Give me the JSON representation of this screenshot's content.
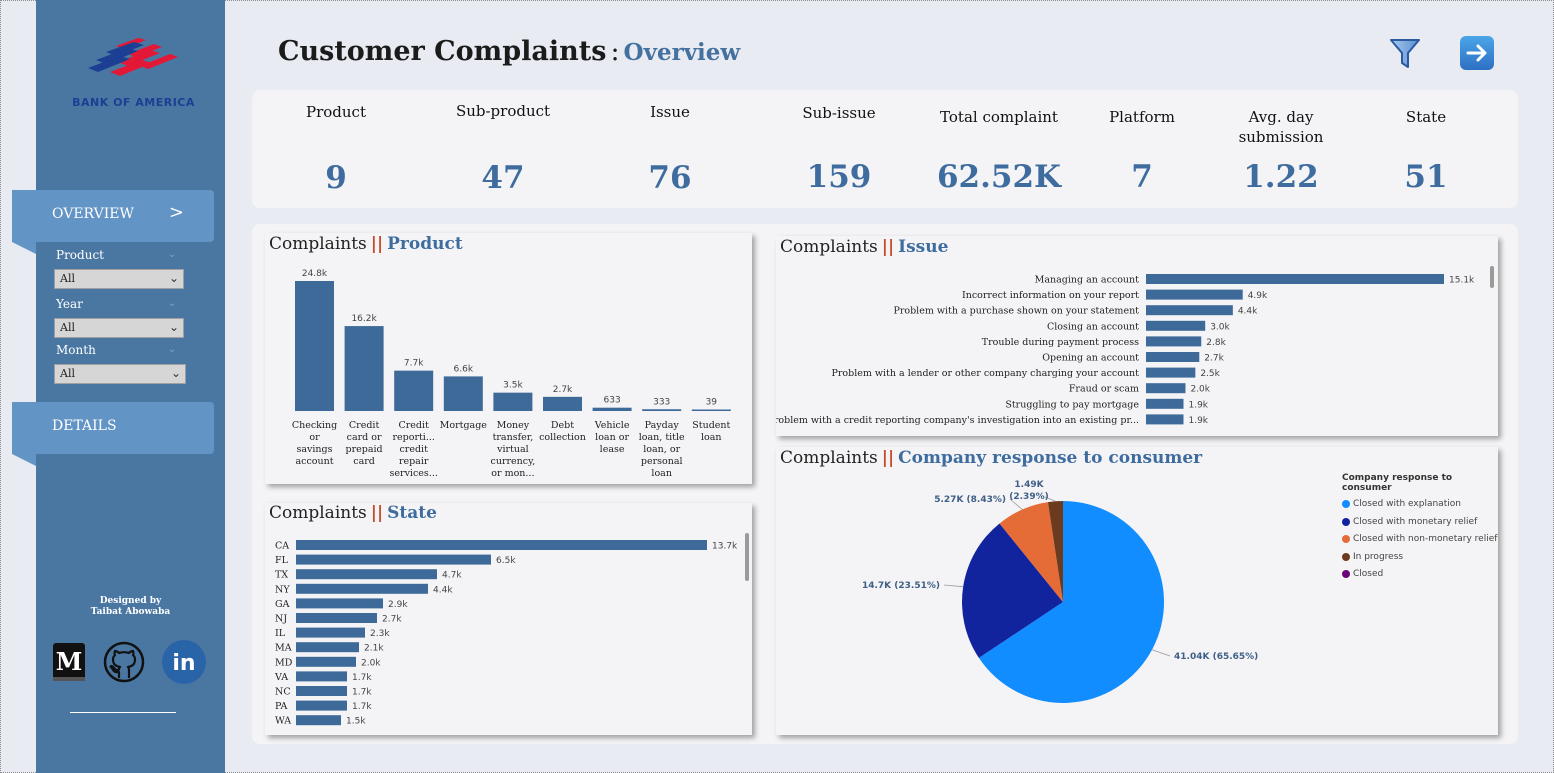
{
  "brand": {
    "logo_text": "BANK OF AMERICA"
  },
  "nav": {
    "overview": {
      "label": "OVERVIEW",
      "chevron": ">"
    },
    "details": {
      "label": "DETAILS"
    }
  },
  "slicers": [
    {
      "label": "Product",
      "value": "All"
    },
    {
      "label": "Year",
      "value": "All"
    },
    {
      "label": "Month",
      "value": "All"
    }
  ],
  "credits": {
    "line1": "Designed by",
    "line2": "Taibat Abowaba"
  },
  "social": [
    {
      "name": "medium-icon",
      "glyph": "M"
    },
    {
      "name": "github-icon"
    },
    {
      "name": "linkedin-icon",
      "glyph": "in"
    }
  ],
  "header": {
    "title": "Customer Complaints",
    "separator": ":",
    "subtitle": "Overview"
  },
  "icons": {
    "filter": "filter-icon",
    "next": "arrow-right-icon"
  },
  "kpis": [
    {
      "label": "Product",
      "value": "9"
    },
    {
      "label": "Sub-product",
      "value": "47"
    },
    {
      "label": "Issue",
      "value": "76"
    },
    {
      "label": "Sub-issue",
      "value": "159"
    },
    {
      "label": "Total complaint",
      "value": "62.52K"
    },
    {
      "label": "Platform",
      "value": "7"
    },
    {
      "label": "Avg. day submission",
      "value": "1.22"
    },
    {
      "label": "State",
      "value": "51"
    }
  ],
  "colors": {
    "bar": "#3d6a98",
    "accent_sep": "#c44a2a",
    "title_blue": "#3f6c9f",
    "sidebar": "#4a76a2",
    "nav_tab": "#6394c6"
  },
  "chart_data": [
    {
      "id": "product",
      "type": "bar",
      "title_prefix": "Complaints",
      "title_separator": "||",
      "title": "Product",
      "categories": [
        [
          "Checking",
          "or",
          "savings",
          "account"
        ],
        [
          "Credit",
          "card or",
          "prepaid",
          "card"
        ],
        [
          "Credit",
          "reporti...",
          "credit",
          "repair",
          "services..."
        ],
        [
          "Mortgage"
        ],
        [
          "Money",
          "transfer,",
          "virtual",
          "currency,",
          "or mon..."
        ],
        [
          "Debt",
          "collection"
        ],
        [
          "Vehicle",
          "loan or",
          "lease"
        ],
        [
          "Payday",
          "loan, title",
          "loan, or",
          "personal",
          "loan"
        ],
        [
          "Student",
          "loan"
        ]
      ],
      "values": [
        24800,
        16200,
        7700,
        6600,
        3500,
        2700,
        633,
        333,
        39
      ],
      "labels": [
        "24.8k",
        "16.2k",
        "7.7k",
        "6.6k",
        "3.5k",
        "2.7k",
        "633",
        "333",
        "39"
      ]
    },
    {
      "id": "issue",
      "type": "bar",
      "orientation": "horizontal",
      "title_prefix": "Complaints",
      "title_separator": "||",
      "title": "Issue",
      "categories": [
        "Managing an account",
        "Incorrect information on your report",
        "Problem with a purchase shown on your statement",
        "Closing an account",
        "Trouble during payment process",
        "Opening an account",
        "Problem with a lender or other company charging your account",
        "Fraud or scam",
        "Struggling to pay mortgage",
        "Problem with a credit reporting company's investigation into an existing pr..."
      ],
      "values": [
        15100,
        4900,
        4400,
        3000,
        2800,
        2700,
        2500,
        2000,
        1900,
        1900
      ],
      "labels": [
        "15.1k",
        "4.9k",
        "4.4k",
        "3.0k",
        "2.8k",
        "2.7k",
        "2.5k",
        "2.0k",
        "1.9k",
        "1.9k"
      ]
    },
    {
      "id": "state",
      "type": "bar",
      "orientation": "horizontal",
      "title_prefix": "Complaints",
      "title_separator": "||",
      "title": "State",
      "categories": [
        "CA",
        "FL",
        "TX",
        "NY",
        "GA",
        "NJ",
        "IL",
        "MA",
        "MD",
        "VA",
        "NC",
        "PA",
        "WA"
      ],
      "values": [
        13700,
        6500,
        4700,
        4400,
        2900,
        2700,
        2300,
        2100,
        2000,
        1700,
        1700,
        1700,
        1500
      ],
      "labels": [
        "13.7k",
        "6.5k",
        "4.7k",
        "4.4k",
        "2.9k",
        "2.7k",
        "2.3k",
        "2.1k",
        "2.0k",
        "1.7k",
        "1.7k",
        "1.7k",
        "1.5k"
      ]
    },
    {
      "id": "response",
      "type": "pie",
      "title_prefix": "Complaints",
      "title_separator": "||",
      "title": "Company response to consumer",
      "legend_title": "Company response to consumer",
      "legend_position": "right",
      "slices": [
        {
          "name": "Closed with explanation",
          "value": 41040,
          "label": "41.04K (65.65%)",
          "color": "#118dff"
        },
        {
          "name": "Closed with monetary relief",
          "value": 14700,
          "label": "14.7K (23.51%)",
          "color": "#12239e"
        },
        {
          "name": "Closed with non-monetary relief",
          "value": 5270,
          "label": "5.27K (8.43%)",
          "color": "#e66c37"
        },
        {
          "name": "In progress",
          "value": 1490,
          "label": "1.49K (2.39%)",
          "color": "#6b3a1f"
        },
        {
          "name": "Closed",
          "value": 0,
          "label": "",
          "color": "#6b007b"
        }
      ]
    }
  ]
}
